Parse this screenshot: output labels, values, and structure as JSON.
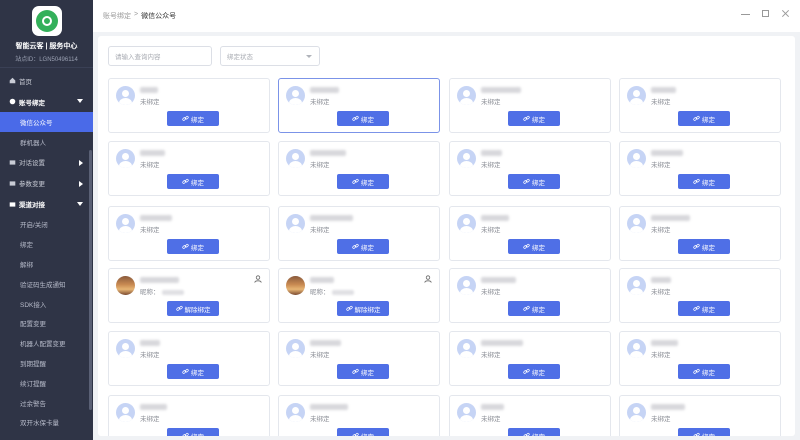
{
  "sidebar": {
    "app_name": "智能云客 | 服务中心",
    "site_id": "站点ID：LGN50496114",
    "menu": {
      "home": "首页",
      "account_binding": "账号绑定",
      "wechat_official": "微信公众号",
      "group_robot": "群机器人",
      "dialog_settings": "对话设置",
      "param_change": "参数变更",
      "channel_docking": "渠道对接",
      "sub_items": [
        "开启/关闭",
        "绑定",
        "解绑",
        "验证码生成通知",
        "SDK接入",
        "配置变更",
        "机器人配置变更",
        "到期提醒",
        "续订提醒",
        "过余警告",
        "双开水保卡量"
      ]
    }
  },
  "header": {
    "breadcrumb_parent": "账号绑定",
    "breadcrumb_sep": ">",
    "breadcrumb_current": "微信公众号"
  },
  "filters": {
    "search_placeholder": "请输入查询内容",
    "status_placeholder": "绑定状态"
  },
  "cards": {
    "unbound_status": "未绑定",
    "bind_label": "绑定",
    "unbind_label": "解除绑定",
    "nickname_prefix": "昵称："
  },
  "colors": {
    "sidebar_bg": "#2f3446",
    "active_menu": "#4a6ae8",
    "button": "#4f6fe6"
  }
}
